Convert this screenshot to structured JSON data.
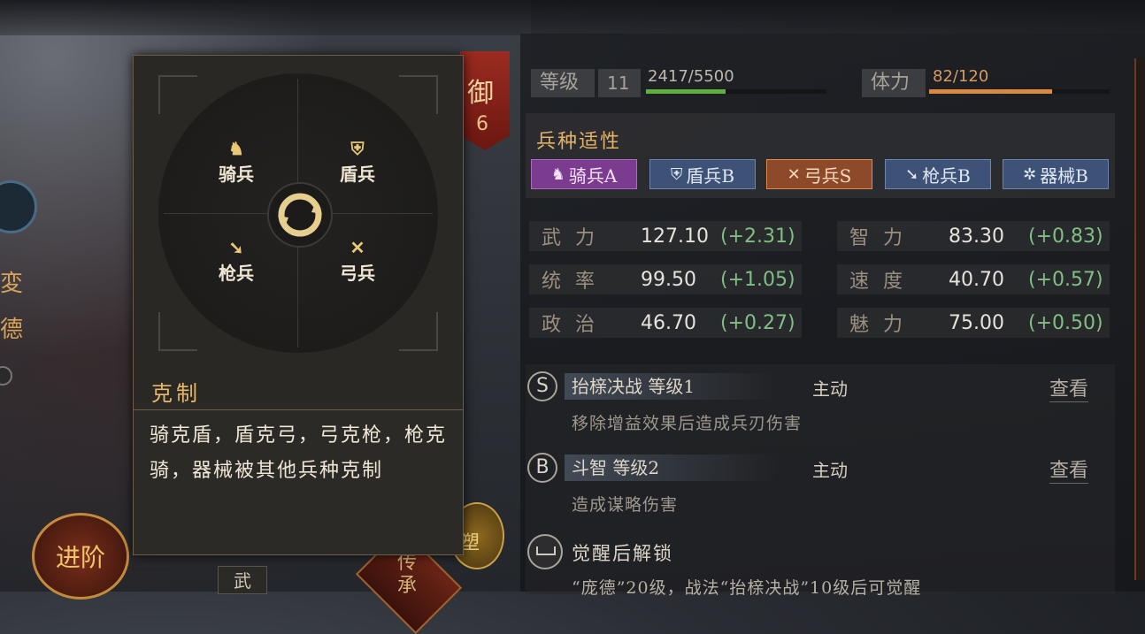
{
  "left": {
    "side_char_1": "変",
    "side_char_2": "德",
    "advance_label": "进阶",
    "inherit_label": "传承",
    "shape_label": "塑",
    "wu_tab": "武"
  },
  "defense": {
    "char": "御",
    "value": "6"
  },
  "counter_popup": {
    "units": [
      {
        "name": "骑兵",
        "icon": "horse-icon"
      },
      {
        "name": "盾兵",
        "icon": "shield-icon"
      },
      {
        "name": "枪兵",
        "icon": "spear-icon"
      },
      {
        "name": "弓兵",
        "icon": "bow-icon"
      }
    ],
    "title": "克制",
    "body": "骑克盾，盾克弓，弓克枪，枪克骑，器械被其他兵种克制"
  },
  "level": {
    "label": "等级",
    "value": "11",
    "xp_text": "2417/5500",
    "xp_ratio": 0.44
  },
  "stamina": {
    "label": "体力",
    "text": "82/120",
    "ratio": 0.68
  },
  "aptitude": {
    "title": "兵种适性",
    "chips": [
      {
        "label": "骑兵A",
        "icon": "horse-icon"
      },
      {
        "label": "盾兵B",
        "icon": "shield-icon"
      },
      {
        "label": "弓兵S",
        "icon": "bow-icon"
      },
      {
        "label": "枪兵B",
        "icon": "spear-icon"
      },
      {
        "label": "器械B",
        "icon": "gear-icon"
      }
    ]
  },
  "stats": [
    {
      "name": "武力",
      "value": "127.10",
      "bonus": "(+2.31)"
    },
    {
      "name": "智力",
      "value": "83.30",
      "bonus": "(+0.83)"
    },
    {
      "name": "统率",
      "value": "99.50",
      "bonus": "(+1.05)"
    },
    {
      "name": "速度",
      "value": "40.70",
      "bonus": "(+0.57)"
    },
    {
      "name": "政治",
      "value": "46.70",
      "bonus": "(+0.27)"
    },
    {
      "name": "魅力",
      "value": "75.00",
      "bonus": "(+0.50)"
    }
  ],
  "skills": [
    {
      "grade": "S",
      "name": "抬榇决战 等级1",
      "type": "主动",
      "view": "查看",
      "desc": "移除增益效果后造成兵刃伤害"
    },
    {
      "grade": "B",
      "name": "斗智 等级2",
      "type": "主动",
      "view": "查看",
      "desc": "造成谋略伤害"
    }
  ],
  "awaken": {
    "title": "觉醒后解锁",
    "desc": "“庞德”20级，战法“抬榇决战”10级后可觉醒"
  },
  "colors": {
    "xp_fill": "#5fae3e",
    "stamina_fill": "#d98a3e",
    "bonus_green": "#7fbf84",
    "accent_gold": "#e2b266"
  }
}
